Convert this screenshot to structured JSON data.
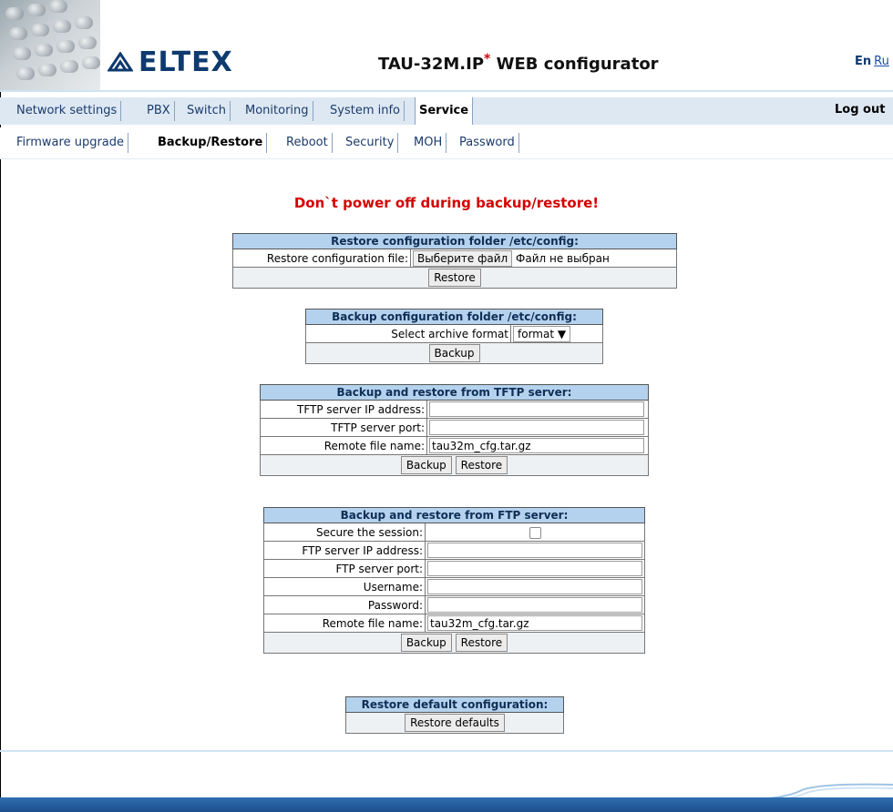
{
  "header": {
    "logo_text": "ELTEX",
    "title_main": "TAU-32M.IP",
    "title_star": "*",
    "title_suffix": "WEB configurator",
    "lang_en": "En",
    "lang_ru": "Ru"
  },
  "nav1": {
    "tabs": [
      "Network settings",
      "PBX",
      "Switch",
      "Monitoring",
      "System info",
      "Service"
    ],
    "active": "Service",
    "logout": "Log out"
  },
  "nav2": {
    "tabs": [
      "Firmware upgrade",
      "Backup/Restore",
      "Reboot",
      "Security",
      "MOH",
      "Password"
    ],
    "active": "Backup/Restore"
  },
  "warning": "Don`t power off during backup/restore!",
  "restore": {
    "title": "Restore configuration folder /etc/config:",
    "file_label": "Restore configuration file:",
    "file_button": "Выберите файл",
    "file_status": "Файл не выбран",
    "action": "Restore"
  },
  "backup": {
    "title": "Backup configuration folder /etc/config:",
    "format_label": "Select archive format",
    "format_value": "format",
    "action": "Backup"
  },
  "tftp": {
    "title": "Backup and restore from TFTP server:",
    "ip_label": "TFTP server IP address:",
    "ip_value": "",
    "port_label": "TFTP server port:",
    "port_value": "",
    "file_label": "Remote file name:",
    "file_value": "tau32m_cfg.tar.gz",
    "backup": "Backup",
    "restore": "Restore"
  },
  "ftp": {
    "title": "Backup and restore from FTP server:",
    "secure_label": "Secure the session:",
    "secure_checked": false,
    "ip_label": "FTP server IP address:",
    "ip_value": "",
    "port_label": "FTP server port:",
    "port_value": "",
    "user_label": "Username:",
    "user_value": "",
    "pass_label": "Password:",
    "pass_value": "",
    "file_label": "Remote file name:",
    "file_value": "tau32m_cfg.tar.gz",
    "backup": "Backup",
    "restore": "Restore"
  },
  "defaults": {
    "title": "Restore default configuration:",
    "action": "Restore defaults"
  },
  "colors": {
    "brand": "#0e3a6e",
    "warning": "#d40000",
    "table_header": "#b4d2ee",
    "nav_bg": "#dde8f3"
  }
}
